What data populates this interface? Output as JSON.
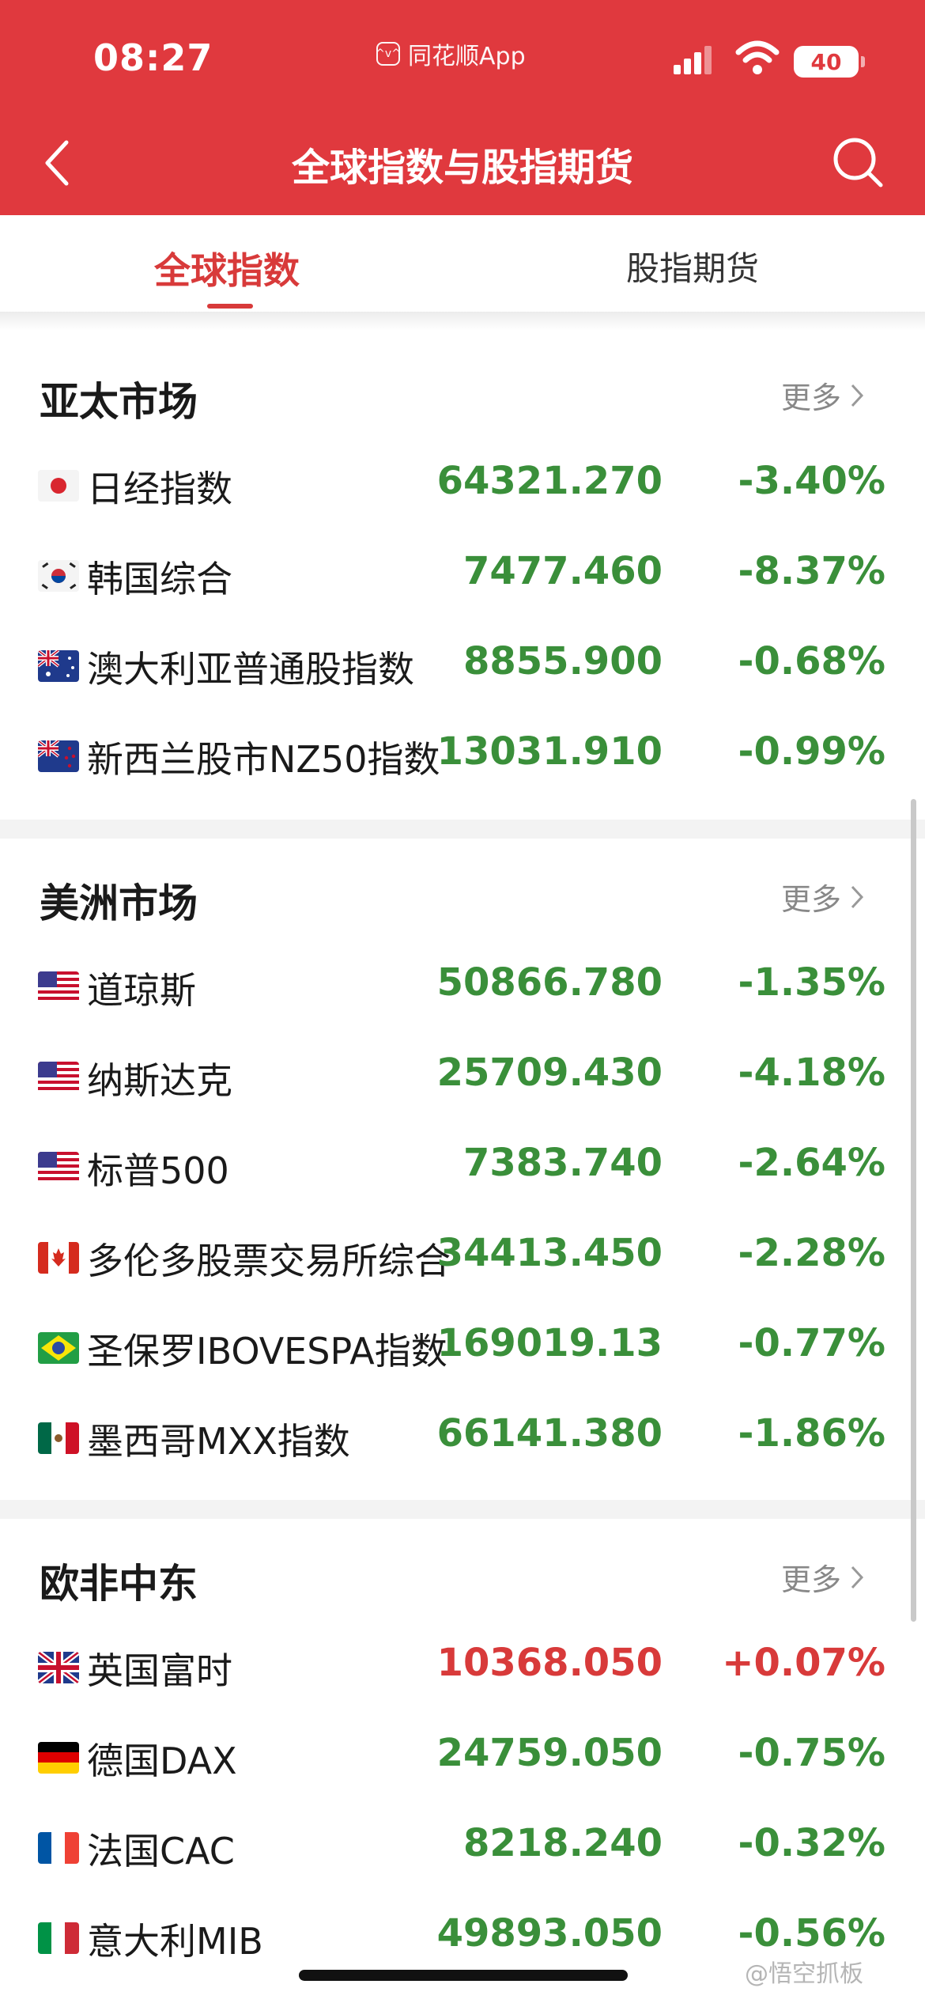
{
  "status_bar": {
    "time": "08:27",
    "app_label": "同花顺App",
    "battery": "40",
    "app_logo_glyph": "^v^"
  },
  "header": {
    "title": "全球指数与股指期货"
  },
  "tabs": [
    {
      "label": "全球指数",
      "active": true
    },
    {
      "label": "股指期货",
      "active": false
    }
  ],
  "more_label": "更多",
  "sections": [
    {
      "title": "亚太市场",
      "rows": [
        {
          "flag": "jp",
          "name": "日经指数",
          "value": "64321.270",
          "change": "-3.40%"
        },
        {
          "flag": "kr",
          "name": "韩国综合",
          "value": "7477.460",
          "change": "-8.37%"
        },
        {
          "flag": "au",
          "name": "澳大利亚普通股指数",
          "value": "8855.900",
          "change": "-0.68%"
        },
        {
          "flag": "nz",
          "name": "新西兰股市NZ50指数",
          "value": "13031.910",
          "change": "-0.99%"
        }
      ]
    },
    {
      "title": "美洲市场",
      "rows": [
        {
          "flag": "us",
          "name": "道琼斯",
          "value": "50866.780",
          "change": "-1.35%"
        },
        {
          "flag": "us",
          "name": "纳斯达克",
          "value": "25709.430",
          "change": "-4.18%"
        },
        {
          "flag": "us",
          "name": "标普500",
          "value": "7383.740",
          "change": "-2.64%"
        },
        {
          "flag": "ca",
          "name": "多伦多股票交易所综合",
          "value": "34413.450",
          "change": "-2.28%"
        },
        {
          "flag": "br",
          "name": "圣保罗IBOVESPA指数",
          "value": "169019.13",
          "change": "-0.77%"
        },
        {
          "flag": "mx",
          "name": "墨西哥MXX指数",
          "value": "66141.380",
          "change": "-1.86%"
        }
      ]
    },
    {
      "title": "欧非中东",
      "rows": [
        {
          "flag": "gb",
          "name": "英国富时",
          "value": "10368.050",
          "change": "+0.07%"
        },
        {
          "flag": "de",
          "name": "德国DAX",
          "value": "24759.050",
          "change": "-0.75%"
        },
        {
          "flag": "fr",
          "name": "法国CAC",
          "value": "8218.240",
          "change": "-0.32%"
        },
        {
          "flag": "it",
          "name": "意大利MIB",
          "value": "49893.050",
          "change": "-0.56%"
        }
      ]
    }
  ],
  "watermark": "@悟空抓板",
  "colors": {
    "header": "#e0393e",
    "up": "#d83a3a",
    "down": "#3a8f3a"
  }
}
